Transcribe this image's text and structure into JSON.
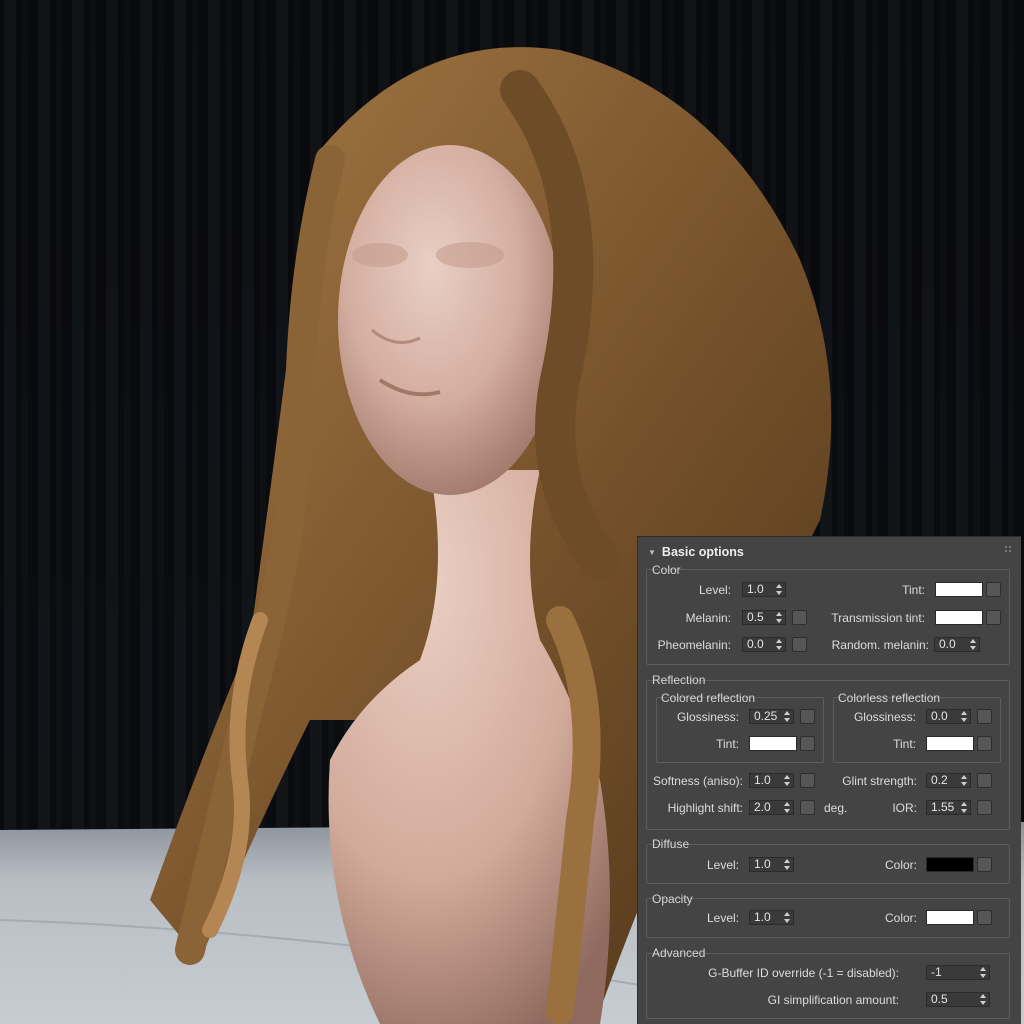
{
  "panel": {
    "title": "Basic options",
    "color": {
      "group_title": "Color",
      "level_label": "Level:",
      "level_value": "1.0",
      "tint_label": "Tint:",
      "tint_color": "#ffffff",
      "melanin_label": "Melanin:",
      "melanin_value": "0.5",
      "transmission_tint_label": "Transmission tint:",
      "transmission_tint_color": "#ffffff",
      "pheomelanin_label": "Pheomelanin:",
      "pheomelanin_value": "0.0",
      "random_melanin_label": "Random. melanin:",
      "random_melanin_value": "0.0"
    },
    "reflection": {
      "group_title": "Reflection",
      "colored": {
        "title": "Colored reflection",
        "glossiness_label": "Glossiness:",
        "glossiness_value": "0.25",
        "tint_label": "Tint:",
        "tint_color": "#ffffff"
      },
      "colorless": {
        "title": "Colorless reflection",
        "glossiness_label": "Glossiness:",
        "glossiness_value": "0.0",
        "tint_label": "Tint:",
        "tint_color": "#ffffff"
      },
      "softness_label": "Softness (aniso):",
      "softness_value": "1.0",
      "glint_label": "Glint strength:",
      "glint_value": "0.2",
      "highlight_label": "Highlight shift:",
      "highlight_value": "2.0",
      "highlight_unit": "deg.",
      "ior_label": "IOR:",
      "ior_value": "1.55"
    },
    "diffuse": {
      "group_title": "Diffuse",
      "level_label": "Level:",
      "level_value": "1.0",
      "color_label": "Color:",
      "color": "#000000"
    },
    "opacity": {
      "group_title": "Opacity",
      "level_label": "Level:",
      "level_value": "1.0",
      "color_label": "Color:",
      "color": "#ffffff"
    },
    "advanced": {
      "group_title": "Advanced",
      "gbuffer_label": "G-Buffer ID override (-1 = disabled):",
      "gbuffer_value": "-1",
      "gi_label": "GI simplification amount:",
      "gi_value": "0.5"
    }
  }
}
